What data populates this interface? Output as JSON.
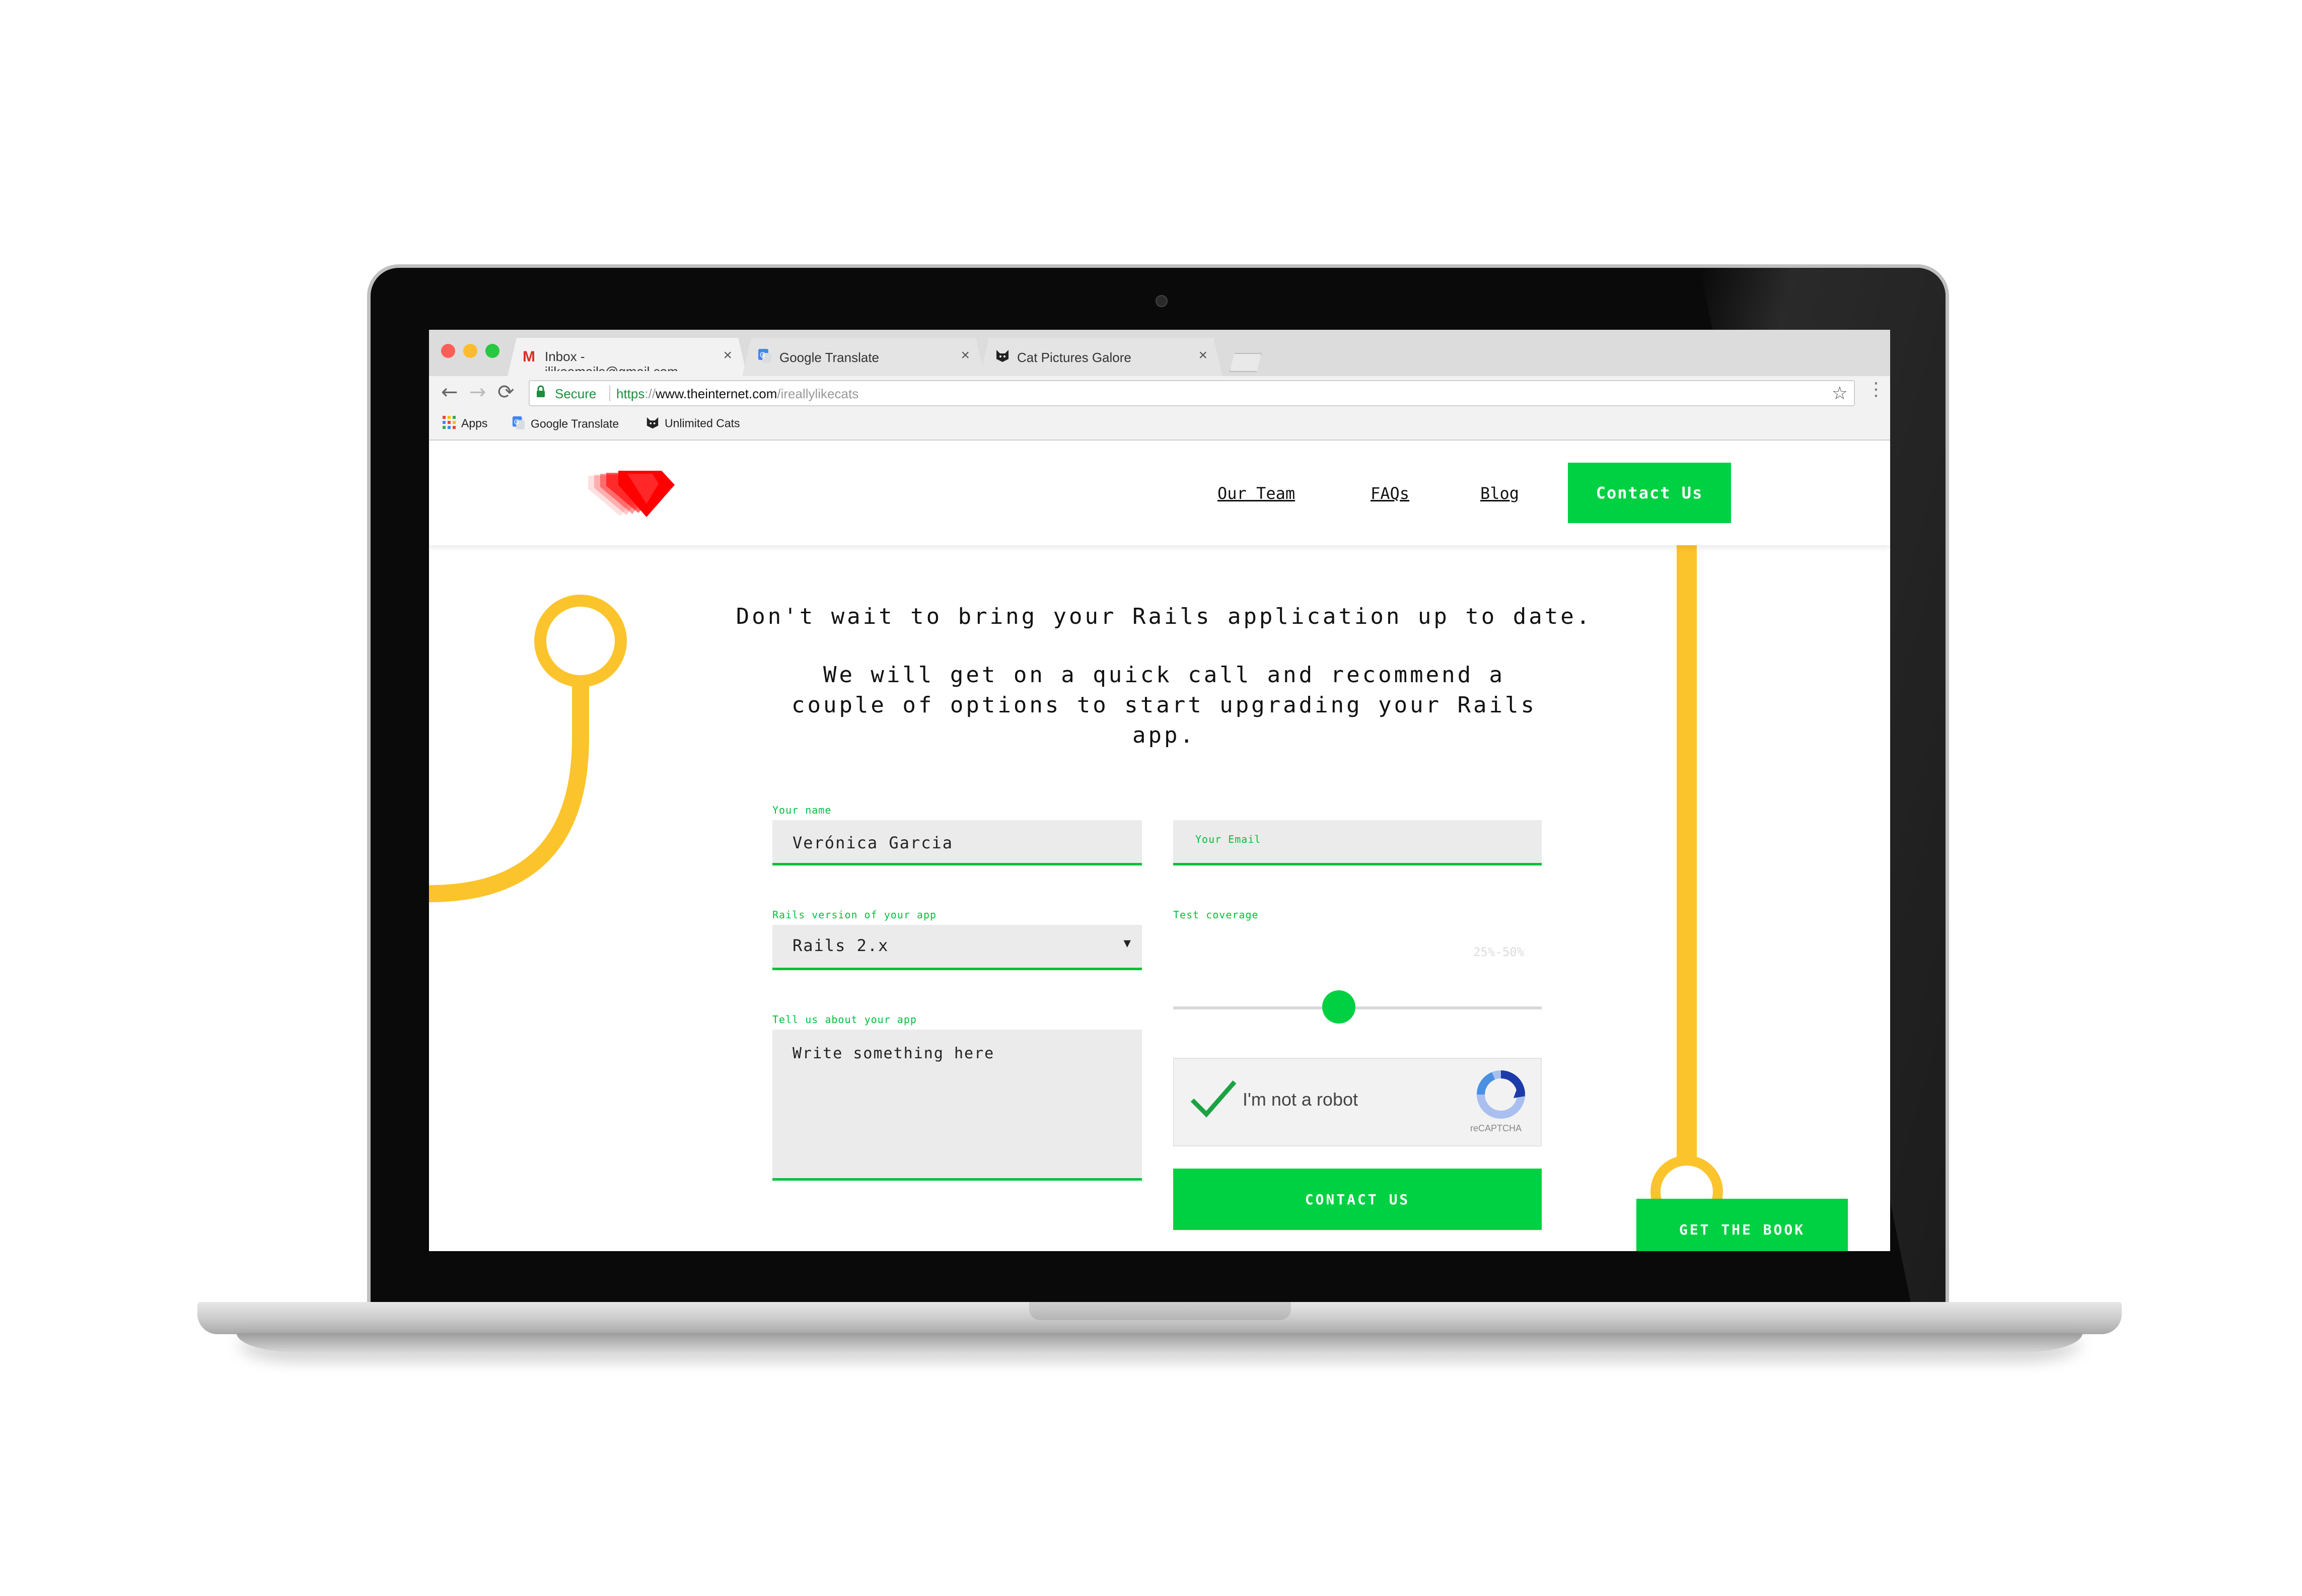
{
  "browser": {
    "tabs": [
      {
        "title": "Inbox - ilikeemails@gmail.com",
        "icon": "gmail-icon"
      },
      {
        "title": "Google Translate",
        "icon": "google-translate-icon"
      },
      {
        "title": "Cat Pictures Galore",
        "icon": "cat-icon"
      }
    ],
    "close_glyph": "×",
    "omnibox": {
      "secure_label": "Secure",
      "url_scheme": "https",
      "url_sep": "://",
      "url_domain": "www.theinternet.com",
      "url_path": "/ireallylikecats"
    },
    "bookmarks": [
      {
        "label": "Apps",
        "icon": "apps-grid-icon"
      },
      {
        "label": "Google Translate",
        "icon": "google-translate-icon"
      },
      {
        "label": "Unlimited Cats",
        "icon": "cat-icon"
      }
    ]
  },
  "site": {
    "nav": {
      "our_team": "Our Team",
      "faqs": "FAQs",
      "blog": "Blog",
      "contact": "Contact Us"
    },
    "headline_1": "Don't wait to bring your Rails application up to date.",
    "headline_2": "We will get on a quick call and recommend a couple of options to start upgrading your Rails app.",
    "form": {
      "name_label": "Your name",
      "name_value": "Verónica Garcia",
      "email_placeholder": "Your Email",
      "rails_label": "Rails version of your app",
      "rails_value": "Rails 2.x",
      "coverage_label": "Test coverage",
      "coverage_value": "25%-50%",
      "coverage_position": 0.45,
      "about_label": "Tell us about your app",
      "about_placeholder": "Write something here",
      "recaptcha_label": "I'm not a robot",
      "recaptcha_brand": "reCAPTCHA",
      "submit": "CONTACT US"
    },
    "book_button": "GET THE BOOK"
  },
  "colors": {
    "accent_green": "#00d142",
    "label_green": "#00c13c",
    "deco_yellow": "#fcc42c",
    "logo_red": "#ff0000"
  }
}
